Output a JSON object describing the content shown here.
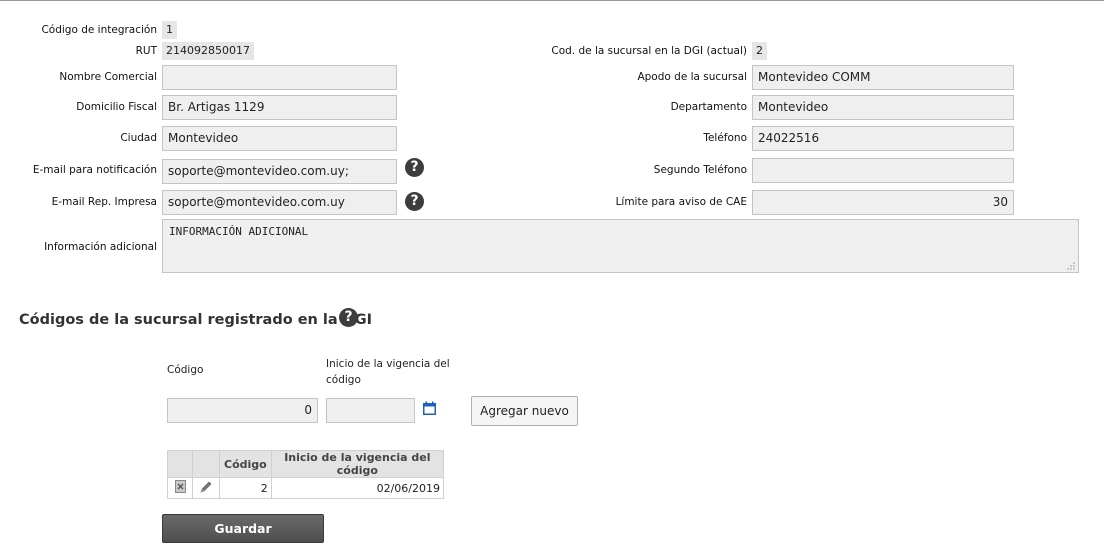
{
  "form": {
    "codigo_integracion": {
      "label": "Código de integración",
      "value": "1"
    },
    "rut": {
      "label": "RUT",
      "value": "214092850017"
    },
    "cod_sucursal_dgi": {
      "label": "Cod. de la sucursal en la DGI (actual)",
      "value": "2"
    },
    "nombre_comercial": {
      "label": "Nombre Comercial",
      "value": ""
    },
    "apodo_sucursal": {
      "label": "Apodo de la sucursal",
      "value": "Montevideo COMM"
    },
    "domicilio_fiscal": {
      "label": "Domicilio Fiscal",
      "value": "Br. Artigas 1129"
    },
    "departamento": {
      "label": "Departamento",
      "value": "Montevideo"
    },
    "ciudad": {
      "label": "Ciudad",
      "value": "Montevideo"
    },
    "telefono": {
      "label": "Teléfono",
      "value": "24022516"
    },
    "email_notificacion": {
      "label": "E-mail para notificación",
      "value": "soporte@montevideo.com.uy;"
    },
    "segundo_telefono": {
      "label": "Segundo Teléfono",
      "value": ""
    },
    "email_rep_impresa": {
      "label": "E-mail Rep. Impresa",
      "value": "soporte@montevideo.com.uy"
    },
    "limite_aviso_cae": {
      "label": "Límite para aviso de CAE",
      "value": "30"
    },
    "info_adicional": {
      "label": "Información adicional",
      "value": "INFORMACIÓN ADICIONAL"
    }
  },
  "help_icon_glyph": "?",
  "codes_section": {
    "title": "Códigos de la sucursal registrado en la DGI",
    "codigo_label": "Código",
    "inicio_label_line1": "Inicio de la vigencia del",
    "inicio_label_line2": "código",
    "codigo_value": "0",
    "fecha_value": "",
    "add_button": "Agregar nuevo",
    "table": {
      "headers": [
        "",
        "",
        "Código",
        "Inicio de la vigencia del código"
      ],
      "rows": [
        {
          "codigo": "2",
          "inicio": "02/06/2019"
        }
      ]
    }
  },
  "save_button": "Guardar",
  "colors": {
    "accent_icon": "#1f5fbf",
    "help_bg": "#3d3d3d",
    "save_bg": "#555555"
  }
}
